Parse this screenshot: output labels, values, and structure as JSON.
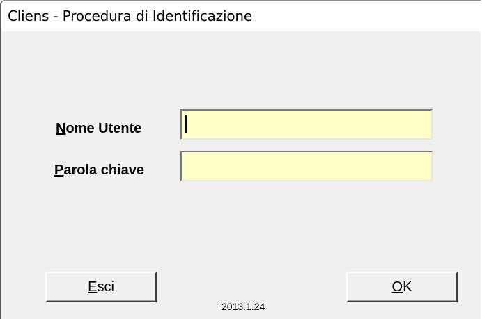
{
  "window": {
    "title": "Cliens - Procedura di Identificazione"
  },
  "form": {
    "username": {
      "label_accel": "N",
      "label_rest": "ome Utente",
      "value": ""
    },
    "password": {
      "label_accel": "P",
      "label_rest": "arola chiave",
      "value": ""
    },
    "field_color": "#ffffc8"
  },
  "buttons": {
    "exit": {
      "accel": "E",
      "rest": "sci"
    },
    "ok": {
      "accel": "O",
      "rest": "K"
    }
  },
  "version": "2013.1.24"
}
